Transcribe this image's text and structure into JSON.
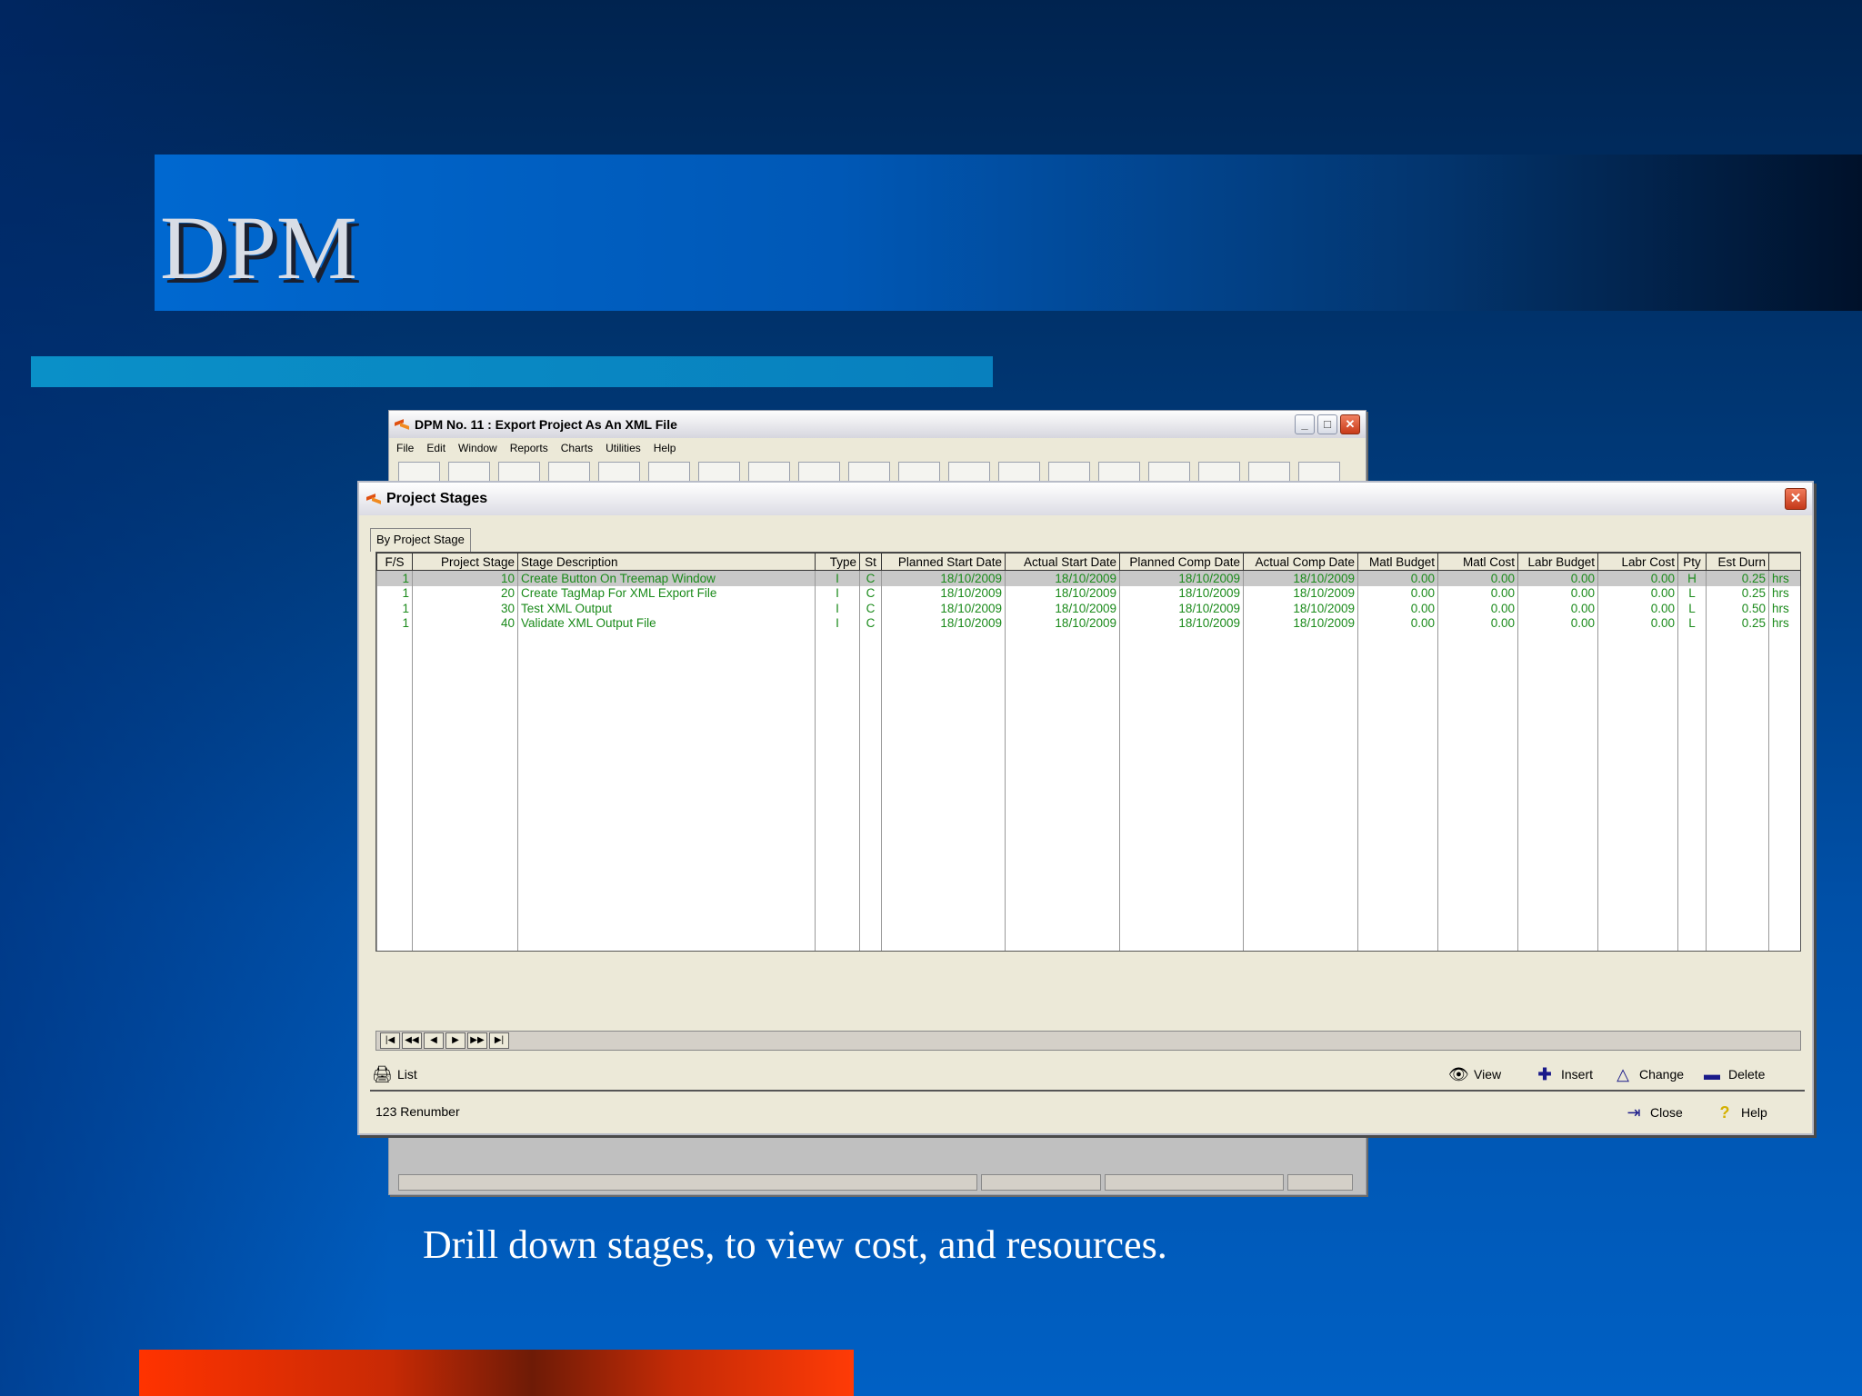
{
  "slide": {
    "title": "DPM",
    "caption": "Drill down stages, to view cost, and resources."
  },
  "back_window": {
    "title": "DPM No. 11 : Export Project As An XML File",
    "menu": [
      "File",
      "Edit",
      "Window",
      "Reports",
      "Charts",
      "Utilities",
      "Help"
    ]
  },
  "front_window": {
    "title": "Project Stages",
    "tab": "By Project Stage",
    "columns": [
      "F/S",
      "Project Stage",
      "Stage Description",
      "Type",
      "St",
      "Planned Start Date",
      "Actual Start Date",
      "Planned Comp Date",
      "Actual Comp Date",
      "Matl Budget",
      "Matl Cost",
      "Labr Budget",
      "Labr Cost",
      "Pty",
      "Est Durn",
      ""
    ],
    "rows": [
      {
        "fs": "1",
        "stage": "10",
        "desc": "Create Button On Treemap Window",
        "type": "I",
        "st": "C",
        "psd": "18/10/2009",
        "asd": "18/10/2009",
        "pcd": "18/10/2009",
        "acd": "18/10/2009",
        "mb": "0.00",
        "mc": "0.00",
        "lb": "0.00",
        "lc": "0.00",
        "pty": "H",
        "est": "0.25",
        "unit": "hrs"
      },
      {
        "fs": "1",
        "stage": "20",
        "desc": "Create TagMap For XML Export File",
        "type": "I",
        "st": "C",
        "psd": "18/10/2009",
        "asd": "18/10/2009",
        "pcd": "18/10/2009",
        "acd": "18/10/2009",
        "mb": "0.00",
        "mc": "0.00",
        "lb": "0.00",
        "lc": "0.00",
        "pty": "L",
        "est": "0.25",
        "unit": "hrs"
      },
      {
        "fs": "1",
        "stage": "30",
        "desc": "Test XML Output",
        "type": "I",
        "st": "C",
        "psd": "18/10/2009",
        "asd": "18/10/2009",
        "pcd": "18/10/2009",
        "acd": "18/10/2009",
        "mb": "0.00",
        "mc": "0.00",
        "lb": "0.00",
        "lc": "0.00",
        "pty": "L",
        "est": "0.50",
        "unit": "hrs"
      },
      {
        "fs": "1",
        "stage": "40",
        "desc": "Validate XML Output File",
        "type": "I",
        "st": "C",
        "psd": "18/10/2009",
        "asd": "18/10/2009",
        "pcd": "18/10/2009",
        "acd": "18/10/2009",
        "mb": "0.00",
        "mc": "0.00",
        "lb": "0.00",
        "lc": "0.00",
        "pty": "L",
        "est": "0.25",
        "unit": "hrs"
      }
    ],
    "actions": {
      "list": "List",
      "view": "View",
      "insert": "Insert",
      "change": "Change",
      "delete": "Delete"
    },
    "footer": {
      "renumber": "123 Renumber",
      "close": "Close",
      "help": "Help"
    }
  }
}
